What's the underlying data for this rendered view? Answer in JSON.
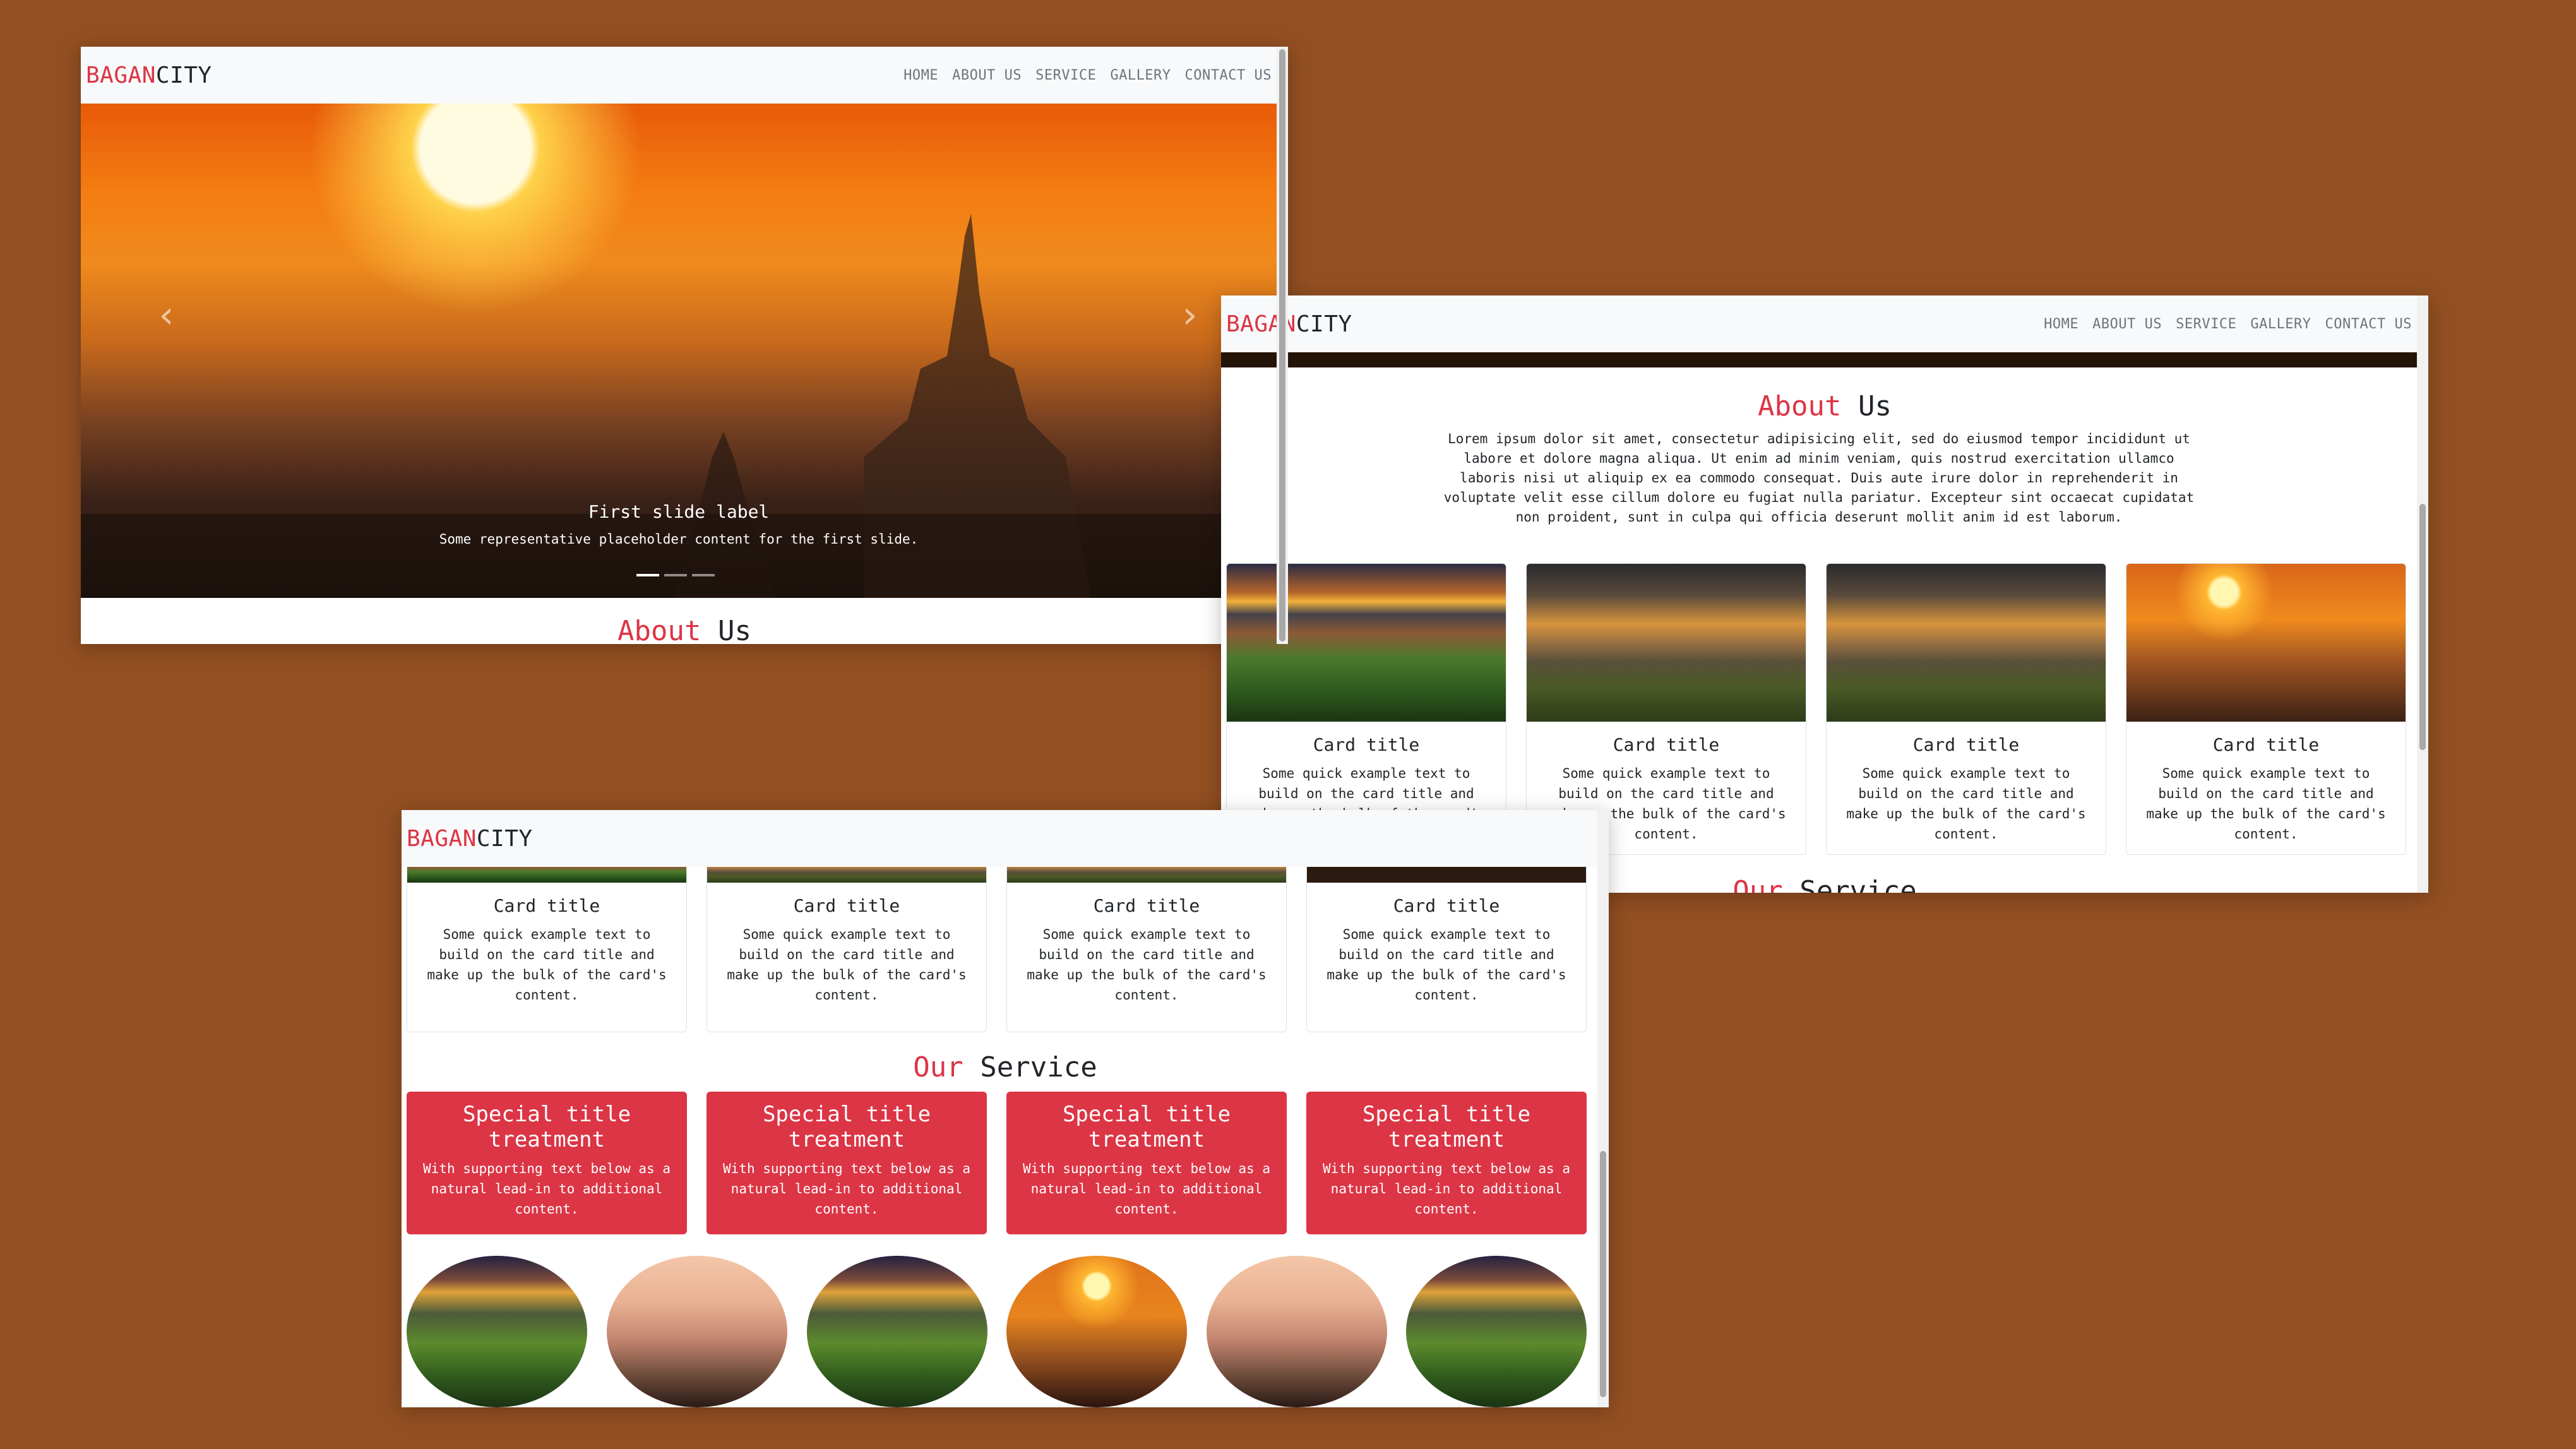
{
  "brand": {
    "part1": "BAGAN",
    "part2": "CITY"
  },
  "nav": [
    "HOME",
    "ABOUT US",
    "SERVICE",
    "GALLERY",
    "CONTACT US"
  ],
  "carousel": {
    "caption_title": "First slide label",
    "caption_text": "Some representative placeholder content for the first slide.",
    "prev_icon": "chevron-left-icon",
    "next_icon": "chevron-right-icon",
    "indicators": 3,
    "active_indicator": 1
  },
  "about": {
    "heading_red": "About",
    "heading_dark": " Us",
    "lines": [
      "Lorem ipsum dolor sit amet, consectetur adipisicing elit, sed do eiusmod tempor incididunt ut",
      "labore et dolore magna aliqua. Ut enim ad minim veniam, quis nostrud exercitation ullamco",
      "laboris nisi ut aliquip ex ea commodo consequat. Duis aute irure dolor in reprehenderit in",
      "voluptate velit esse cillum dolore eu fugiat nulla pariatur. Excepteur sint occaecat cupidatat",
      "non proident, sunt in culpa qui officia deserunt mollit anim id est laborum."
    ]
  },
  "cards": [
    {
      "title": "Card title",
      "text_lines": [
        "Some quick example text to",
        "build on the card title and",
        "make up the bulk of the card's",
        "content."
      ]
    },
    {
      "title": "Card title",
      "text_lines": [
        "Some quick example text to",
        "build on the card title and",
        "make up the bulk of the card's",
        "content."
      ]
    },
    {
      "title": "Card title",
      "text_lines": [
        "Some quick example text to",
        "build on the card title and",
        "make up the bulk of the card's",
        "content."
      ]
    },
    {
      "title": "Card title",
      "text_lines": [
        "Some quick example text to",
        "build on the card title and",
        "make up the bulk of the card's",
        "content."
      ]
    }
  ],
  "service": {
    "heading_red": "Our",
    "heading_dark": " Service",
    "items": [
      {
        "title_lines": [
          "Special title",
          "treatment"
        ],
        "text_lines": [
          "With supporting text below as a",
          "natural lead-in to additional",
          "content."
        ]
      },
      {
        "title_lines": [
          "Special title",
          "treatment"
        ],
        "text_lines": [
          "With supporting text below as a",
          "natural lead-in to additional",
          "content."
        ]
      },
      {
        "title_lines": [
          "Special title",
          "treatment"
        ],
        "text_lines": [
          "With supporting text below as a",
          "natural lead-in to additional",
          "content."
        ]
      },
      {
        "title_lines": [
          "Special title",
          "treatment"
        ],
        "text_lines": [
          "With supporting text below as a",
          "natural lead-in to additional",
          "content."
        ]
      }
    ]
  },
  "colors": {
    "background": "#924f22",
    "accent": "#dc3545",
    "navbar": "#f8f9fa"
  }
}
